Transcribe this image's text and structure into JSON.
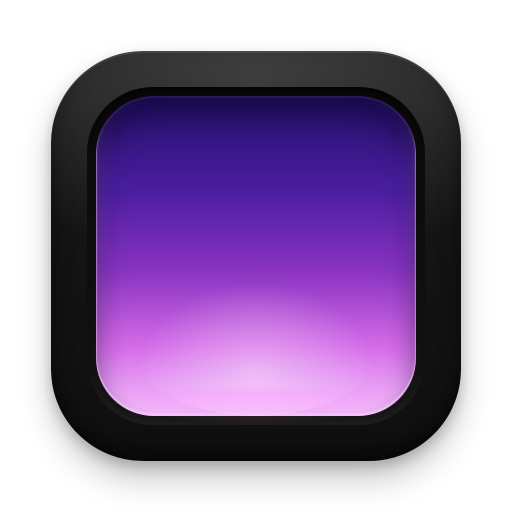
{
  "app_icon": {
    "frame_color": "#141414",
    "screen_gradient": [
      "#25106a",
      "#4b1ea1",
      "#8a34c2",
      "#d46ae7",
      "#f6c2ff"
    ]
  }
}
